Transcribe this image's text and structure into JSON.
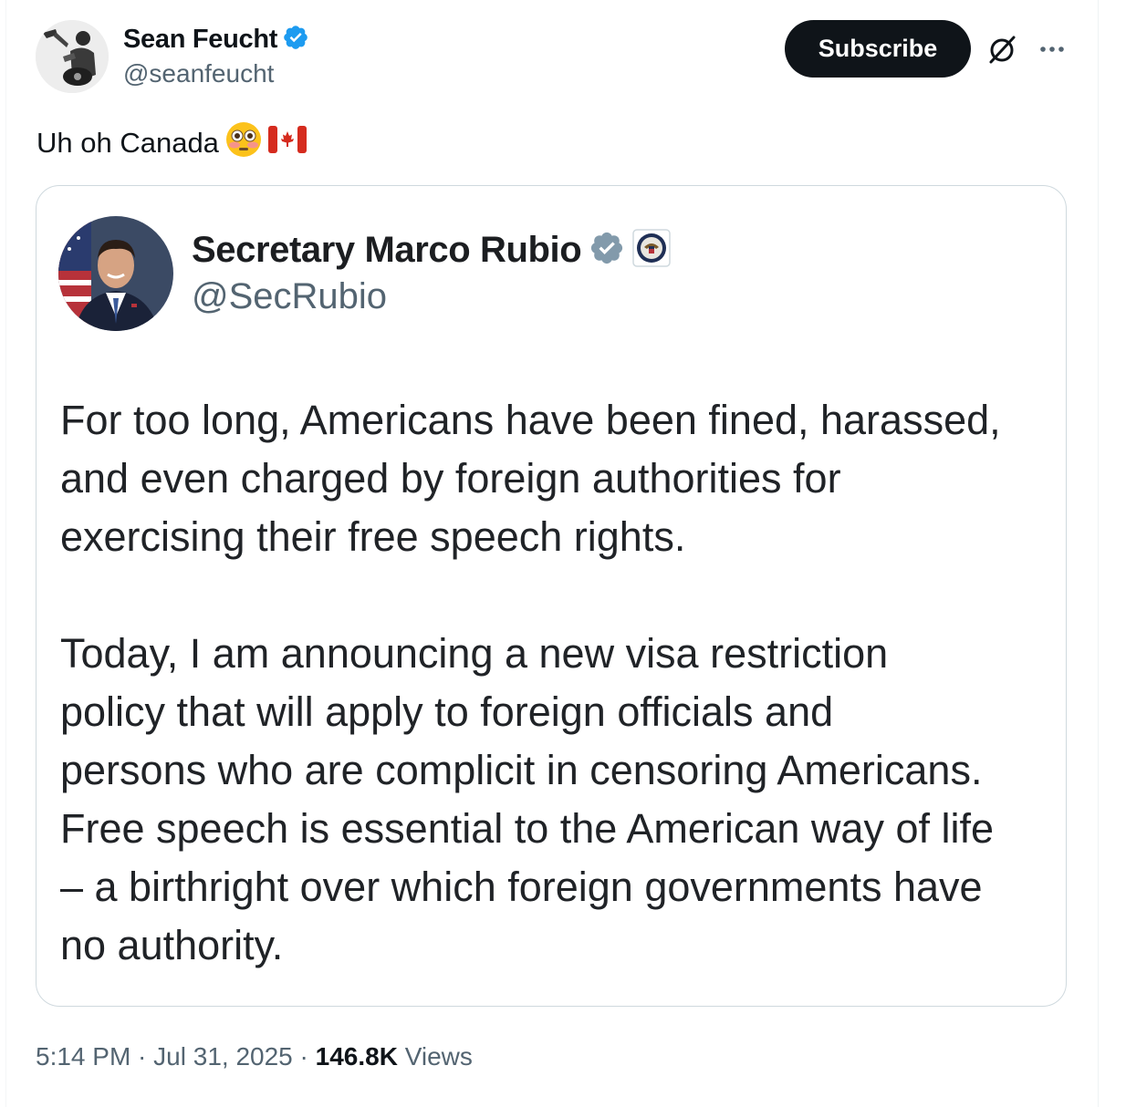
{
  "post": {
    "author_name": "Sean Feucht",
    "author_handle": "@seanfeucht",
    "subscribe_label": "Subscribe",
    "text": "Uh oh Canada",
    "emojis": [
      "flushed-face-emoji",
      "canada-flag-emoji"
    ],
    "time": "5:14 PM",
    "separator": " · ",
    "date": "Jul 31, 2025",
    "views_count": "146.8K",
    "views_label": " Views"
  },
  "quoted": {
    "author_name": "Secretary Marco Rubio",
    "author_handle": "@SecRubio",
    "paragraphs": [
      "For too long, Americans have been fined, harassed,\nand even charged by foreign authorities for\nexercising their free speech rights.",
      "Today, I am announcing a new visa restriction\npolicy that will apply to foreign officials and\npersons who are complicit in censoring Americans.\nFree speech is essential to the American way of life\n– a birthright over which foreign governments have\nno authority."
    ]
  },
  "icons": {
    "verified": "verified-badge-icon",
    "grok": "grok-icon",
    "more": "more-icon",
    "state_seal": "state-department-seal-icon"
  },
  "colors": {
    "verified_blue": "#1d9bf0",
    "verified_gray": "#829aab",
    "secondary_text": "#536471",
    "primary_text": "#0f1419",
    "border": "#cfd9de",
    "canada_red": "#d52b1e"
  }
}
